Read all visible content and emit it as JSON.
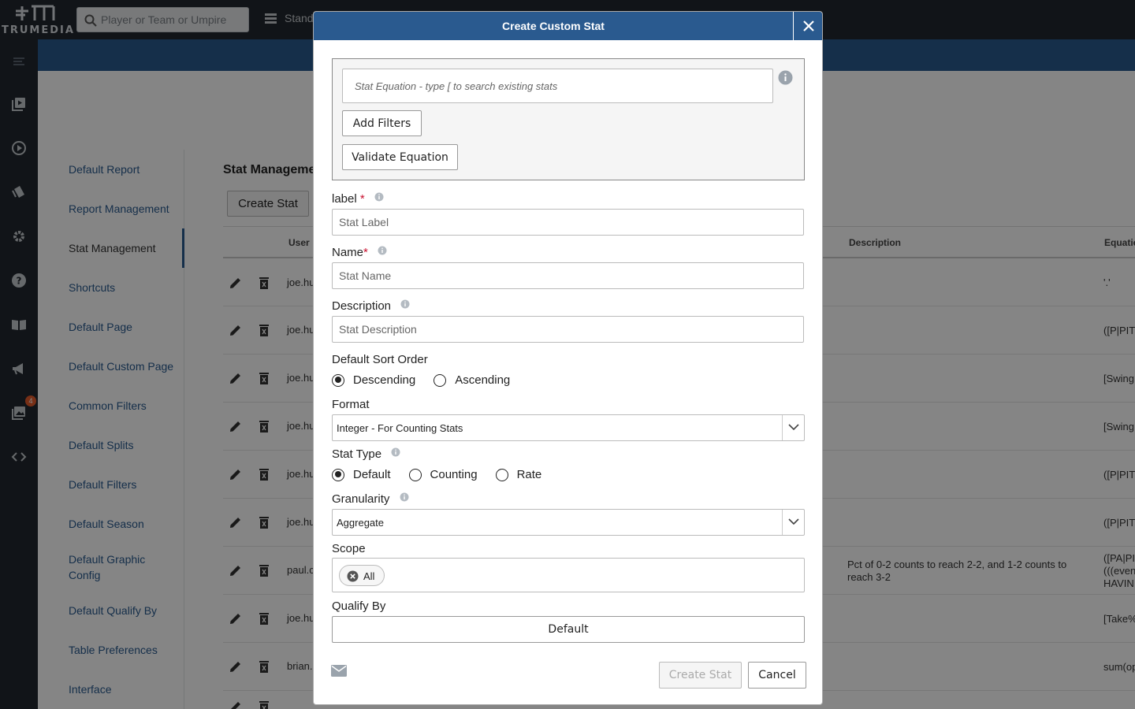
{
  "topbar": {
    "logo_text": "TRUMEDIA",
    "search_placeholder": "Player or Team or Umpire",
    "nav_label": "Stand"
  },
  "rail": {
    "notification_count": "4"
  },
  "settings_menu": {
    "items": [
      "Default Report",
      "Report Management",
      "Stat Management",
      "Shortcuts",
      "Default Page",
      "Default Custom Page",
      "Common Filters",
      "Default Splits",
      "Default Filters",
      "Default Season",
      "Default Graphic Config",
      "Default Qualify By",
      "Table Preferences",
      "Interface"
    ],
    "active_index": 2
  },
  "stat_management": {
    "title": "Stat Manageme",
    "create_button": "Create Stat",
    "columns": {
      "user": "User",
      "description": "Description",
      "equation": "Equatio"
    },
    "rows": [
      {
        "user": "joe.hu",
        "description": "",
        "equation": "'.'"
      },
      {
        "user": "joe.hu",
        "description": "",
        "equation": "([P|PIT"
      },
      {
        "user": "joe.hu",
        "description": "",
        "equation": "[Swing"
      },
      {
        "user": "joe.hu",
        "description": "",
        "equation": "[Swing"
      },
      {
        "user": "joe.hu",
        "description": "",
        "equation": "([P|PIT"
      },
      {
        "user": "joe.hu",
        "description": "",
        "equation": "([P|PIT"
      },
      {
        "user": "paul.c",
        "description": "Pct of 0-2 counts to reach 2-2, and 1-2 counts to reach 3-2",
        "equation": "([PA|PI\n(((even\nHAVIN"
      },
      {
        "user": "joe.hu",
        "description": "",
        "equation": "[Take%"
      },
      {
        "user": "brian.",
        "description": "",
        "equation": "sum(op"
      },
      {
        "user": "",
        "description": "",
        "equation": ""
      }
    ]
  },
  "modal": {
    "title": "Create Custom Stat",
    "equation_placeholder": "Stat Equation - type [ to search existing stats",
    "add_filters": "Add Filters",
    "validate_equation": "Validate Equation",
    "label_label": "label",
    "label_required": "*",
    "label_placeholder": "Stat Label",
    "name_label": "Name",
    "name_required": "*",
    "name_placeholder": "Stat Name",
    "description_label": "Description",
    "description_placeholder": "Stat Description",
    "sort_order_label": "Default Sort Order",
    "sort_options": [
      "Descending",
      "Ascending"
    ],
    "sort_selected": 0,
    "format_label": "Format",
    "format_value": "Integer - For Counting Stats",
    "stat_type_label": "Stat Type",
    "stat_type_options": [
      "Default",
      "Counting",
      "Rate"
    ],
    "stat_type_selected": 0,
    "granularity_label": "Granularity",
    "granularity_value": "Aggregate",
    "scope_label": "Scope",
    "scope_chip": "All",
    "qualify_label": "Qualify By",
    "qualify_value": "Default",
    "create_button": "Create Stat",
    "cancel_button": "Cancel"
  },
  "colors": {
    "brand_blue": "#2a5a8f",
    "dark_bar": "#22282e",
    "required": "#c8102e"
  }
}
